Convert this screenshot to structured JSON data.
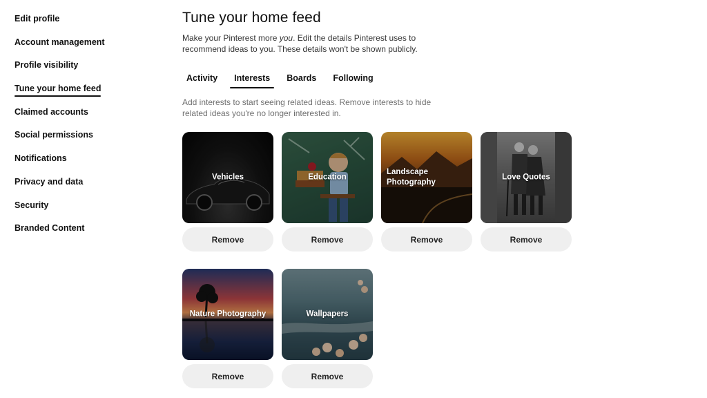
{
  "sidebar": {
    "items": [
      {
        "label": "Edit profile"
      },
      {
        "label": "Account management"
      },
      {
        "label": "Profile visibility"
      },
      {
        "label": "Tune your home feed"
      },
      {
        "label": "Claimed accounts"
      },
      {
        "label": "Social permissions"
      },
      {
        "label": "Notifications"
      },
      {
        "label": "Privacy and data"
      },
      {
        "label": "Security"
      },
      {
        "label": "Branded Content"
      }
    ],
    "active_index": 3
  },
  "main": {
    "title": "Tune your home feed",
    "description_pre": "Make your Pinterest more ",
    "description_em": "you",
    "description_post": ". Edit the details Pinterest uses to recommend ideas to you. These details won't be shown publicly.",
    "tabs": [
      {
        "label": "Activity"
      },
      {
        "label": "Interests"
      },
      {
        "label": "Boards"
      },
      {
        "label": "Following"
      }
    ],
    "active_tab": 1,
    "hint": "Add interests to start seeing related ideas. Remove interests to hide related ideas you're no longer interested in.",
    "interests": [
      {
        "label": "Vehicles",
        "remove_label": "Remove"
      },
      {
        "label": "Education",
        "remove_label": "Remove"
      },
      {
        "label": "Landscape Photography",
        "remove_label": "Remove"
      },
      {
        "label": "Love Quotes",
        "remove_label": "Remove"
      },
      {
        "label": "Nature Photography",
        "remove_label": "Remove"
      },
      {
        "label": "Wallpapers",
        "remove_label": "Remove"
      }
    ]
  }
}
